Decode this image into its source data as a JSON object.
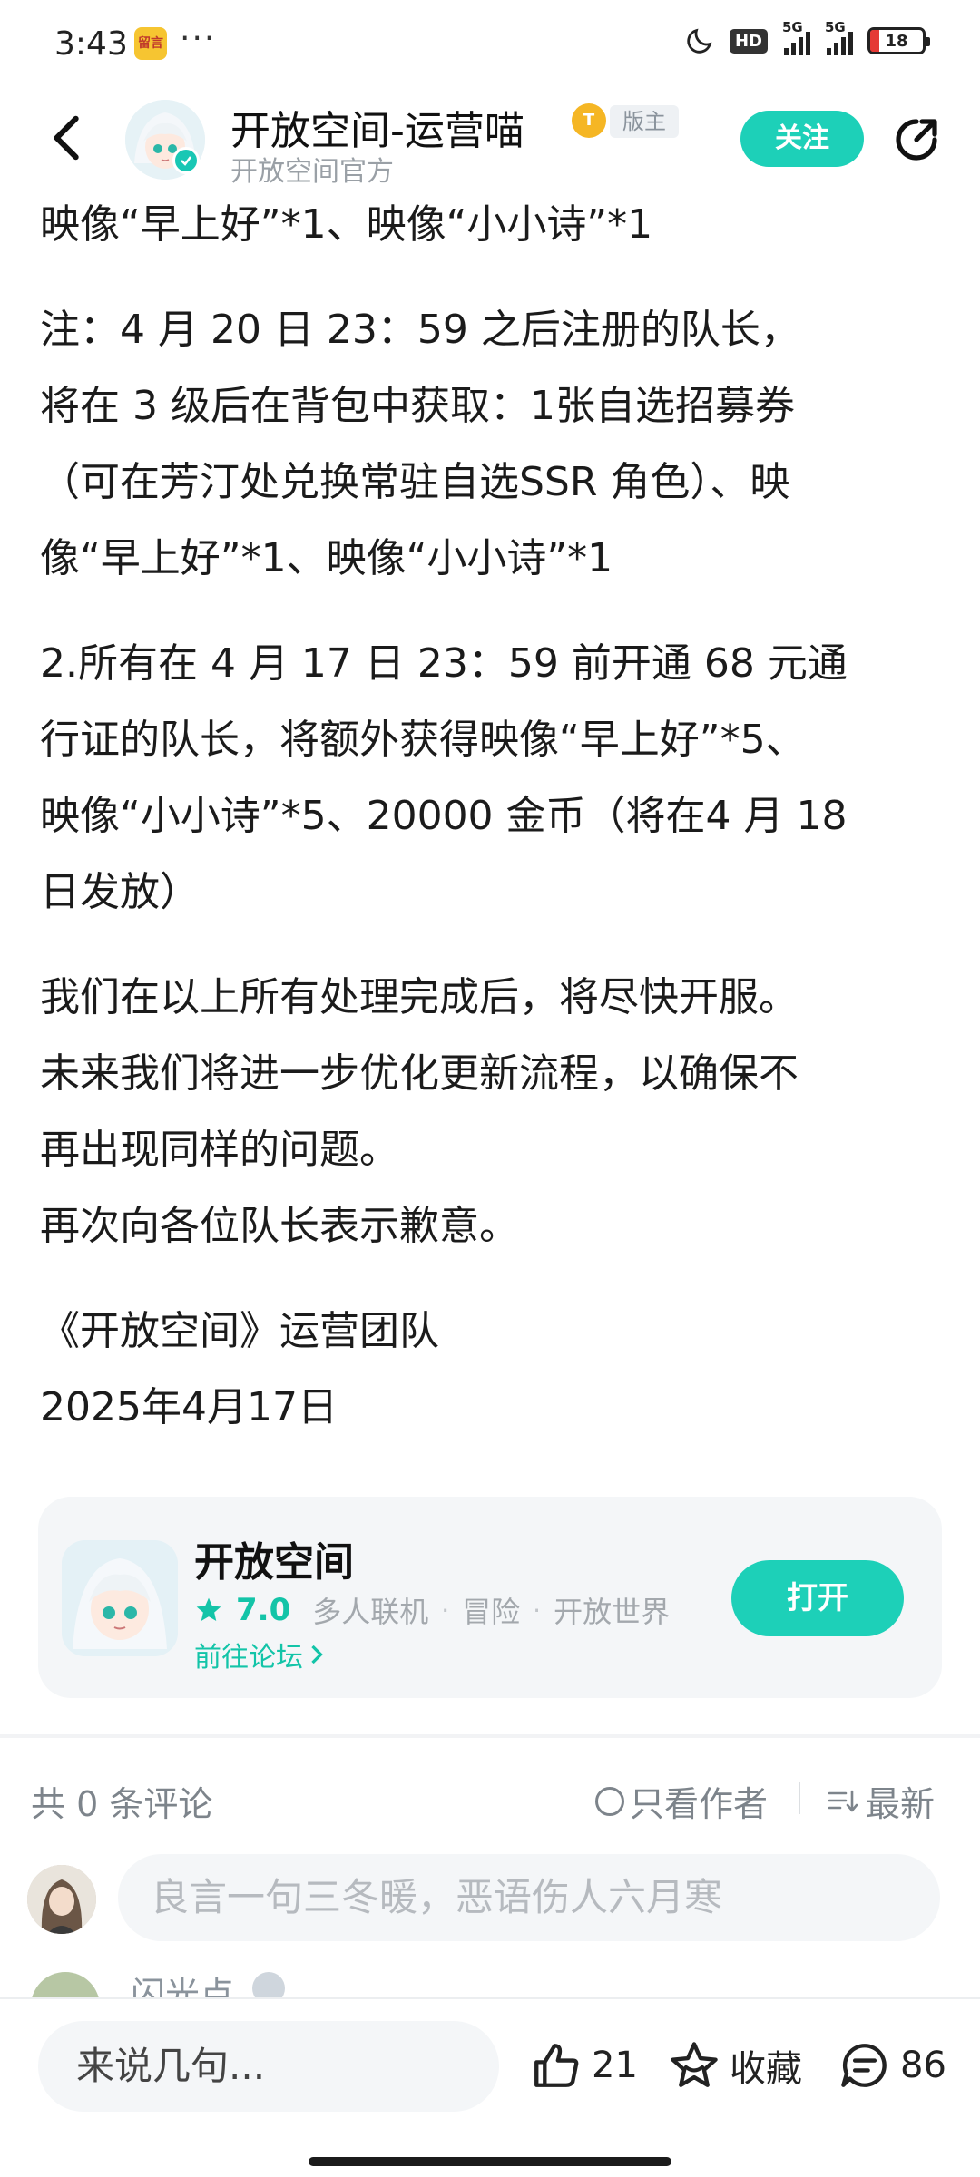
{
  "status_bar": {
    "time": "3:43",
    "more": "···",
    "hd_label": "HD",
    "network_1": "5G",
    "network_2": "5G",
    "battery_level": "18",
    "app_icon_text": "留言"
  },
  "header": {
    "author_name": "开放空间-运营喵",
    "level_badge": "T",
    "moderator_tag": "版主",
    "author_subtitle": "开放空间官方",
    "follow_label": "关注"
  },
  "article": {
    "paragraphs": [
      "映像“早上好”*1、映像“小小诗”*1",
      "注：4 月 20 日 23：59 之后注册的队长，\n将在 3 级后在背包中获取：1张自选招募券\n（可在芳汀处兑换常驻自选SSR 角色）、映\n像“早上好”*1、映像“小小诗”*1",
      "2.所有在 4 月 17 日 23：59 前开通 68 元通\n行证的队长，将额外获得映像“早上好”*5、\n映像“小小诗”*5、20000 金币（将在4 月 18\n日发放）",
      "我们在以上所有处理完成后，将尽快开服。\n未来我们将进一步优化更新流程，以确保不\n再出现同样的问题。\n再次向各位队长表示歉意。",
      "《开放空间》运营团队\n2025年4月17日"
    ]
  },
  "game_card": {
    "title": "开放空间",
    "rating": "7.0",
    "tags": [
      "多人联机",
      "冒险",
      "开放世界"
    ],
    "forum_link": "前往论坛",
    "open_label": "打开"
  },
  "comments": {
    "count_label": "共 0 条评论",
    "author_only_label": "只看作者",
    "sort_label": "最新",
    "input_placeholder": "良言一句三冬暖，恶语伤人六月寒",
    "next_commenter": "闪光点"
  },
  "bottom_bar": {
    "reply_placeholder": "来说几句...",
    "like_count": "21",
    "favorite_label": "收藏",
    "comment_count": "86"
  },
  "colors": {
    "accent": "#1dd0b8",
    "accent_text": "#13c4a8",
    "battery_low": "#e53935",
    "level_badge": "#f5b624"
  }
}
